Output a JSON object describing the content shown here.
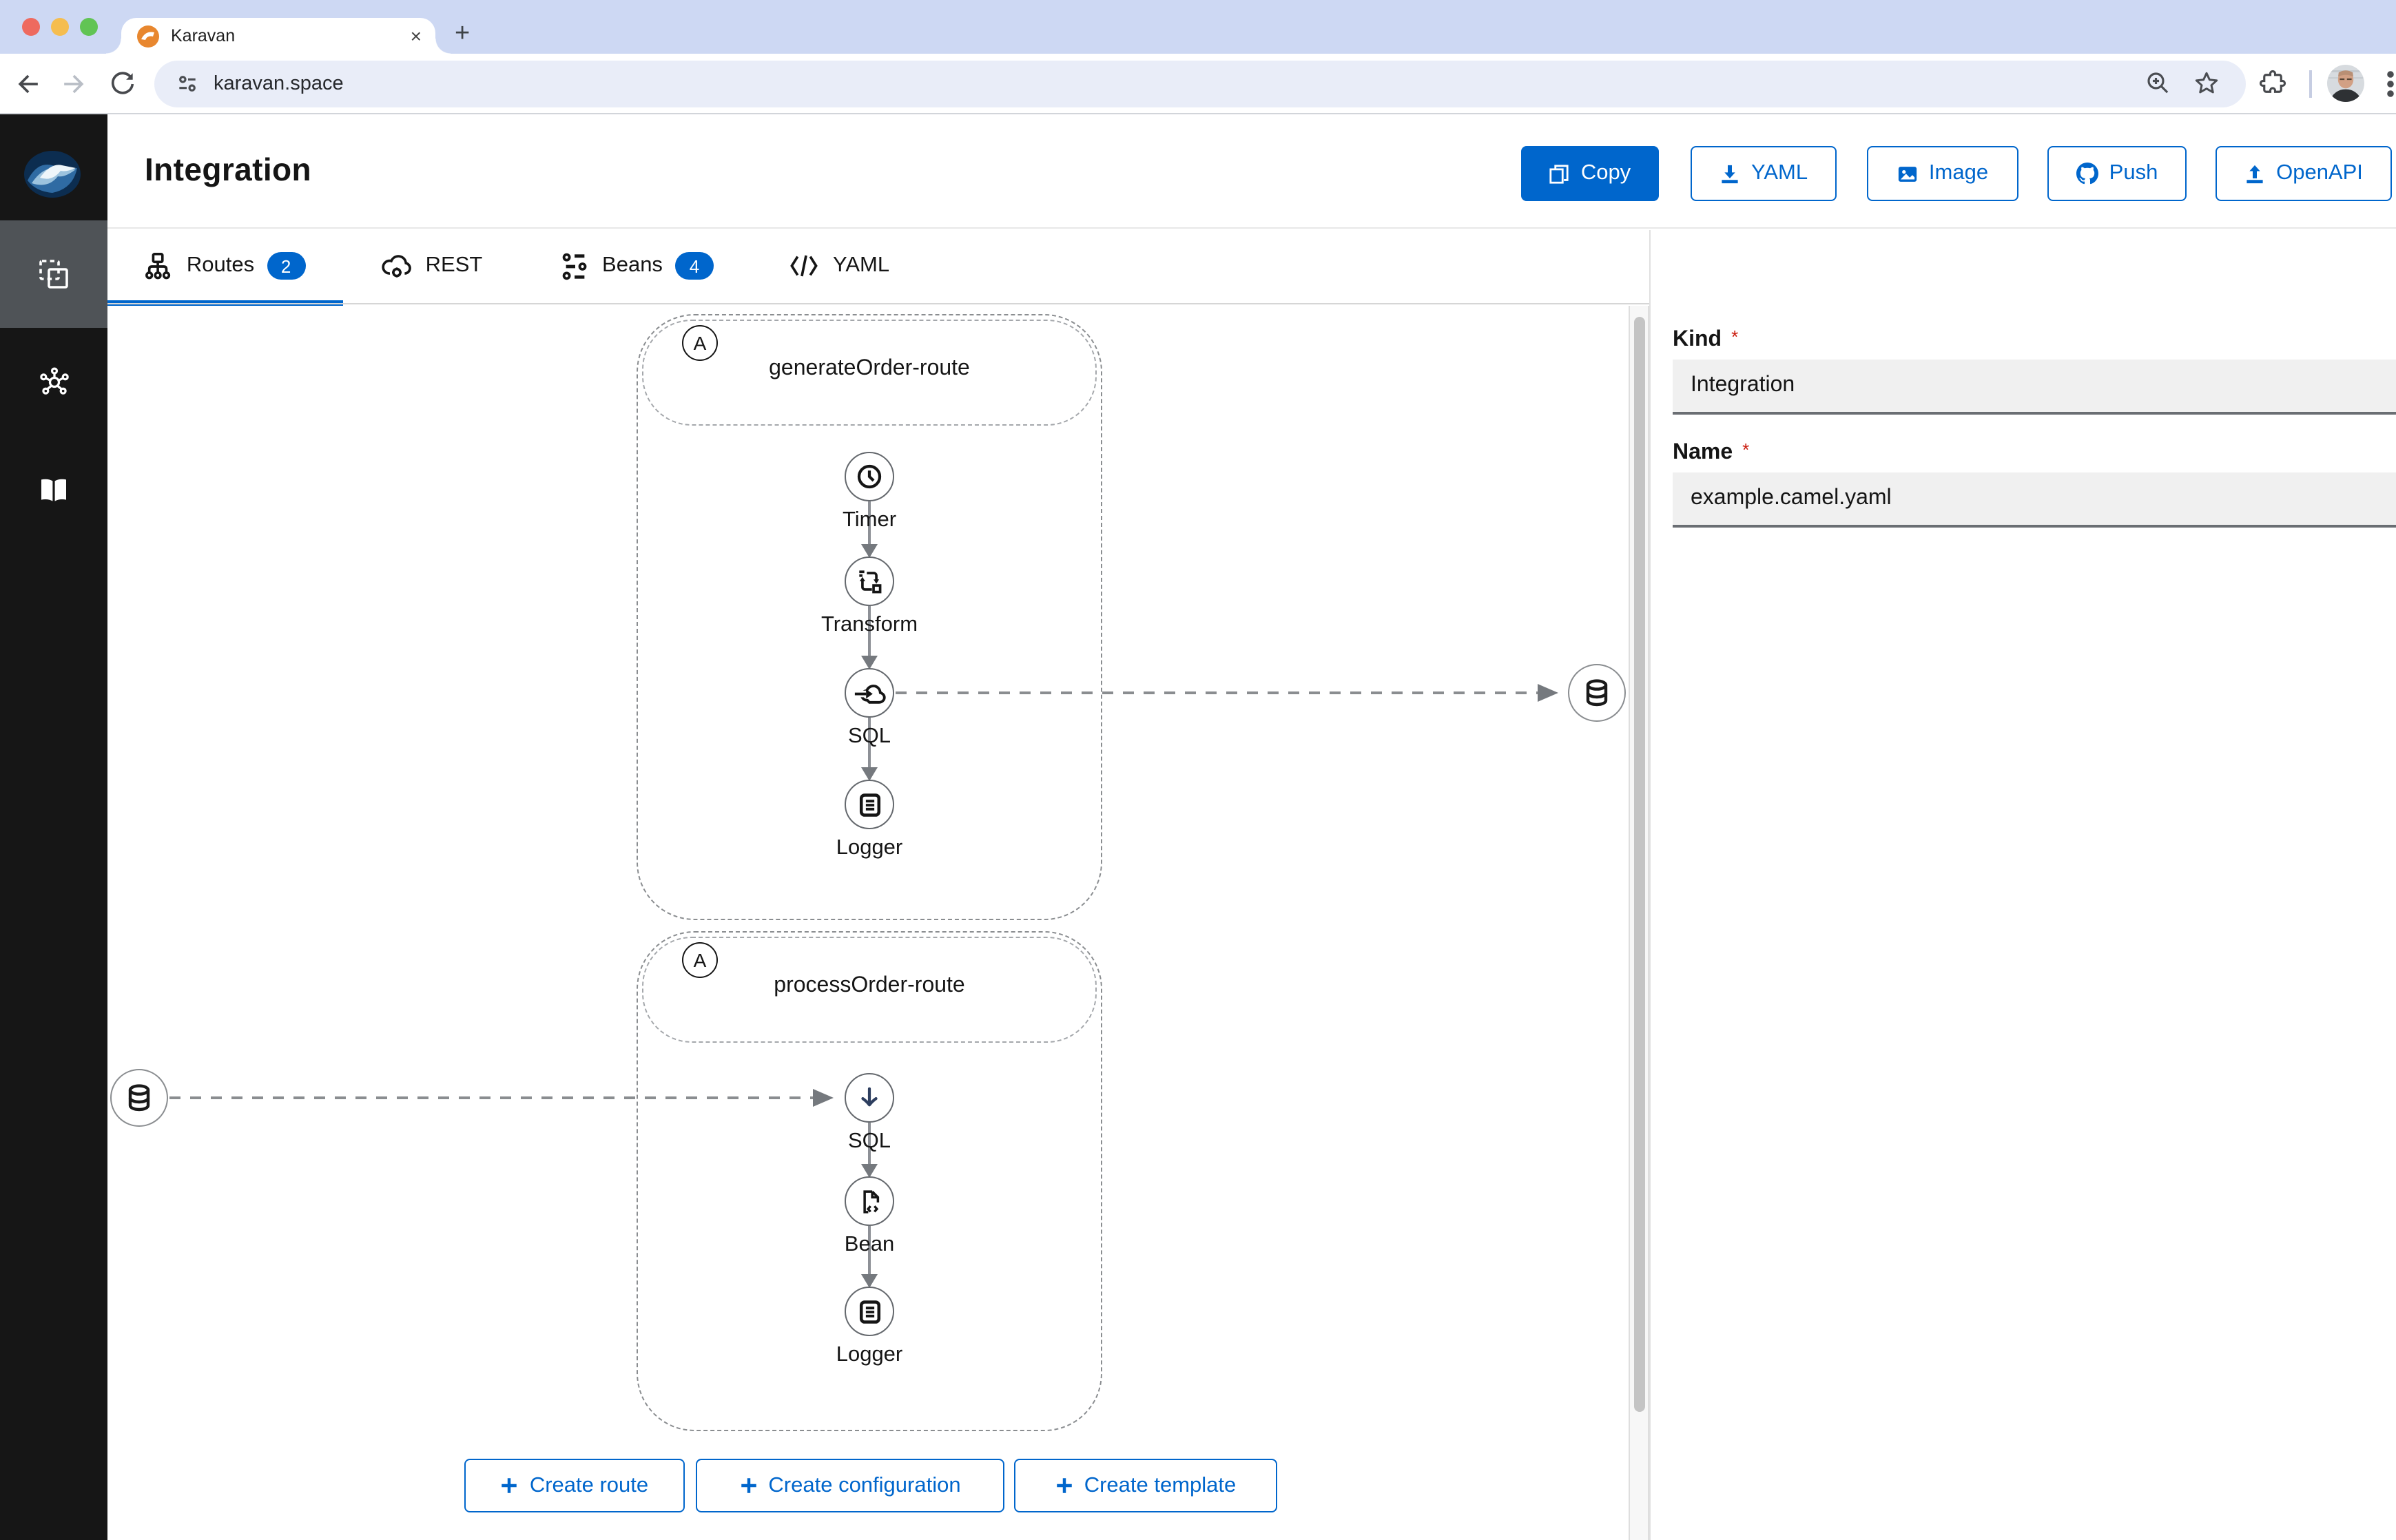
{
  "browser": {
    "tab_title": "Karavan",
    "url": "karavan.space",
    "icons": {
      "close": "×",
      "new_tab": "+"
    }
  },
  "sidebar": {
    "items": [
      {
        "name": "designer",
        "icon": "pages-icon",
        "active": true
      },
      {
        "name": "topology",
        "icon": "hub-icon",
        "active": false
      },
      {
        "name": "knowledgebase",
        "icon": "book-icon",
        "active": false
      }
    ]
  },
  "header": {
    "title": "Integration",
    "buttons": [
      {
        "label": "Copy",
        "icon": "copy-icon",
        "variant": "primary"
      },
      {
        "label": "YAML",
        "icon": "download-icon",
        "variant": "secondary"
      },
      {
        "label": "Image",
        "icon": "image-icon",
        "variant": "secondary"
      },
      {
        "label": "Push",
        "icon": "github-icon",
        "variant": "secondary"
      },
      {
        "label": "OpenAPI",
        "icon": "upload-icon",
        "variant": "secondary"
      }
    ]
  },
  "tabs": [
    {
      "label": "Routes",
      "badge": "2",
      "active": true
    },
    {
      "label": "REST",
      "badge": null,
      "active": false
    },
    {
      "label": "Beans",
      "badge": "4",
      "active": false
    },
    {
      "label": "YAML",
      "badge": null,
      "active": false
    }
  ],
  "canvas": {
    "routes": [
      {
        "badge": "A",
        "name": "generateOrder-route",
        "steps": [
          {
            "label": "Timer",
            "icon": "timer-icon"
          },
          {
            "label": "Transform",
            "icon": "transform-icon"
          },
          {
            "label": "SQL",
            "icon": "cloud-arrow-icon"
          },
          {
            "label": "Logger",
            "icon": "logger-icon"
          }
        ]
      },
      {
        "badge": "A",
        "name": "processOrder-route",
        "steps": [
          {
            "label": "SQL",
            "icon": "arrow-down-icon"
          },
          {
            "label": "Bean",
            "icon": "bean-file-icon"
          },
          {
            "label": "Logger",
            "icon": "logger-icon"
          }
        ]
      }
    ],
    "external_nodes": [
      {
        "icon": "database-icon",
        "connected_to": "generateOrder-route SQL"
      },
      {
        "icon": "database-icon",
        "connected_to": "processOrder-route SQL"
      }
    ],
    "create_buttons": [
      {
        "label": "Create route"
      },
      {
        "label": "Create configuration"
      },
      {
        "label": "Create template"
      }
    ]
  },
  "properties": {
    "kind_label": "Kind",
    "kind_value": "Integration",
    "name_label": "Name",
    "name_value": "example.camel.yaml",
    "required": "*"
  },
  "colors": {
    "primary": "#0066cc",
    "required": "#c9190b",
    "sidebar_bg": "#151515",
    "tabstrip_bg": "#cdd8f3",
    "url_pill_bg": "#e9edf8"
  }
}
